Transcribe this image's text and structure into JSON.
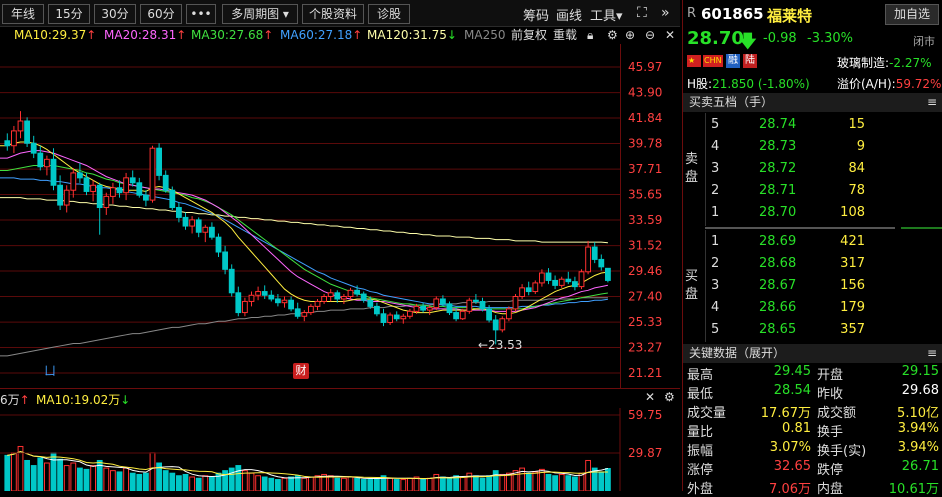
{
  "toolbar": {
    "periods": [
      "年线",
      "15分",
      "30分",
      "60分",
      "•••"
    ],
    "multi_period": "多周期图",
    "stock_info": "个股资料",
    "diagnose": "诊股",
    "chips": "筹码",
    "draw": "画线",
    "tools": "工具",
    "expand_icon": "expand-icon",
    "more_icon": "double-chevron-right-icon"
  },
  "ma_bar": {
    "ma10": "MA10:29.37",
    "ma20": "MA20:28.31",
    "ma30": "MA30:27.68",
    "ma60": "MA60:27.18",
    "ma120": "MA120:31.75",
    "ma250": "MA250",
    "adjust": "前复权",
    "overlay": "重载",
    "colors": {
      "ma10": "#ffee40",
      "ma20": "#ff66ff",
      "ma30": "#40e040",
      "ma60": "#40a0ff",
      "ma120": "#ffffaa",
      "ma250": "#888888"
    }
  },
  "price_axis": [
    "45.97",
    "43.90",
    "41.84",
    "39.78",
    "37.71",
    "35.65",
    "33.59",
    "31.52",
    "29.46",
    "27.40",
    "25.33",
    "23.27",
    "21.21"
  ],
  "low_marker": "←23.53",
  "caitu_badge": "财",
  "volume_bar": {
    "vol_partial": "6万",
    "ma10": "MA10:19.02万"
  },
  "volume_axis": [
    "59.75",
    "29.87"
  ],
  "quote": {
    "r": "R",
    "code": "601865",
    "name": "福莱特",
    "add_watch": "加自选",
    "price": "28.70",
    "change": "-0.98",
    "change_pct": "-3.30%",
    "status": "闭市",
    "tag_chn": "CHN",
    "tag_rong": "融",
    "tag_lu": "陆",
    "sector_label": "玻璃制造",
    "sector_change": "-2.27%",
    "h_label": "H股:",
    "h_price": "21.850",
    "h_change": "(-1.80%)",
    "premium_label": "溢价(A/H):",
    "premium_value": "59.72%"
  },
  "order_book": {
    "title": "买卖五档（手）",
    "sell_label": "卖盘",
    "buy_label": "买盘",
    "sells": [
      {
        "level": "5",
        "price": "28.74",
        "volume": "15"
      },
      {
        "level": "4",
        "price": "28.73",
        "volume": "9"
      },
      {
        "level": "3",
        "price": "28.72",
        "volume": "84"
      },
      {
        "level": "2",
        "price": "28.71",
        "volume": "78"
      },
      {
        "level": "1",
        "price": "28.70",
        "volume": "108"
      }
    ],
    "buys": [
      {
        "level": "1",
        "price": "28.69",
        "volume": "421"
      },
      {
        "level": "2",
        "price": "28.68",
        "volume": "317"
      },
      {
        "level": "3",
        "price": "28.67",
        "volume": "156"
      },
      {
        "level": "4",
        "price": "28.66",
        "volume": "179"
      },
      {
        "level": "5",
        "price": "28.65",
        "volume": "357"
      }
    ]
  },
  "key_data": {
    "title": "关键数据（展开）",
    "rows": [
      {
        "l1": "最高",
        "v1": "29.45",
        "l2": "开盘",
        "v2": "29.15"
      },
      {
        "l1": "最低",
        "v1": "28.54",
        "l2": "昨收",
        "v2": "29.68"
      },
      {
        "l1": "成交量",
        "v1": "17.67万",
        "l2": "成交额",
        "v2": "5.10亿"
      },
      {
        "l1": "量比",
        "v1": "0.81",
        "l2": "换手",
        "v2": "3.94%"
      },
      {
        "l1": "振幅",
        "v1": "3.07%",
        "l2": "换手(实)",
        "v2": "3.94%"
      },
      {
        "l1": "涨停",
        "v1": "32.65",
        "l2": "跌停",
        "v2": "26.71"
      },
      {
        "l1": "外盘",
        "v1": "7.06万",
        "l2": "内盘",
        "v2": "10.61万"
      }
    ]
  },
  "chart_data": {
    "type": "candlestick",
    "ylim": [
      21.21,
      45.97
    ],
    "candles": [
      [
        40.0,
        40.6,
        39.2,
        39.6
      ],
      [
        39.6,
        41.2,
        39.0,
        40.8
      ],
      [
        40.8,
        42.4,
        40.2,
        41.6
      ],
      [
        41.6,
        41.9,
        39.5,
        39.8
      ],
      [
        39.8,
        40.4,
        38.6,
        39.0
      ],
      [
        39.0,
        39.6,
        37.6,
        37.9
      ],
      [
        37.9,
        38.8,
        37.2,
        38.5
      ],
      [
        38.5,
        39.4,
        36.0,
        36.4
      ],
      [
        36.4,
        37.2,
        34.4,
        34.8
      ],
      [
        34.8,
        36.4,
        34.2,
        36.0
      ],
      [
        36.0,
        37.8,
        35.4,
        37.4
      ],
      [
        37.4,
        38.2,
        36.6,
        37.0
      ],
      [
        37.0,
        37.4,
        35.6,
        35.9
      ],
      [
        35.9,
        36.8,
        35.1,
        36.4
      ],
      [
        36.4,
        36.6,
        32.4,
        34.6
      ],
      [
        34.6,
        35.8,
        34.0,
        35.5
      ],
      [
        35.5,
        36.6,
        34.9,
        36.2
      ],
      [
        36.2,
        36.8,
        35.4,
        35.8
      ],
      [
        35.8,
        37.4,
        35.2,
        37.0
      ],
      [
        37.0,
        37.6,
        36.3,
        36.6
      ],
      [
        36.6,
        37.0,
        35.4,
        35.6
      ],
      [
        35.6,
        36.0,
        34.7,
        35.2
      ],
      [
        35.2,
        39.6,
        35.0,
        39.4
      ],
      [
        39.4,
        39.8,
        36.8,
        37.2
      ],
      [
        37.2,
        37.6,
        35.8,
        36.0
      ],
      [
        36.0,
        36.3,
        34.4,
        34.6
      ],
      [
        34.6,
        35.0,
        33.4,
        33.8
      ],
      [
        33.8,
        34.2,
        32.8,
        33.1
      ],
      [
        33.1,
        33.9,
        32.5,
        33.6
      ],
      [
        33.6,
        33.8,
        32.2,
        32.6
      ],
      [
        32.6,
        33.2,
        31.8,
        33.0
      ],
      [
        33.0,
        33.4,
        32.0,
        32.2
      ],
      [
        32.2,
        32.5,
        30.6,
        31.0
      ],
      [
        31.0,
        31.5,
        29.2,
        29.6
      ],
      [
        29.6,
        30.0,
        27.4,
        27.7
      ],
      [
        27.7,
        28.2,
        25.8,
        26.1
      ],
      [
        26.1,
        27.3,
        25.8,
        27.0
      ],
      [
        27.0,
        27.8,
        26.6,
        27.5
      ],
      [
        27.5,
        28.2,
        27.1,
        27.8
      ],
      [
        27.8,
        28.3,
        27.2,
        27.5
      ],
      [
        27.5,
        27.9,
        27.0,
        27.2
      ],
      [
        27.2,
        27.6,
        26.6,
        26.9
      ],
      [
        26.9,
        27.4,
        26.5,
        27.1
      ],
      [
        27.1,
        27.4,
        26.2,
        26.4
      ],
      [
        26.4,
        26.9,
        25.6,
        25.8
      ],
      [
        25.8,
        26.3,
        25.4,
        26.1
      ],
      [
        26.1,
        26.8,
        25.9,
        26.6
      ],
      [
        26.6,
        27.2,
        26.3,
        27.0
      ],
      [
        27.0,
        27.6,
        26.8,
        27.4
      ],
      [
        27.4,
        28.0,
        27.0,
        27.7
      ],
      [
        27.7,
        27.9,
        26.9,
        27.2
      ],
      [
        27.2,
        27.6,
        26.8,
        27.4
      ],
      [
        27.4,
        28.1,
        27.2,
        27.9
      ],
      [
        27.9,
        28.3,
        27.4,
        27.6
      ],
      [
        27.6,
        27.8,
        26.9,
        27.1
      ],
      [
        27.1,
        27.4,
        26.4,
        26.6
      ],
      [
        26.6,
        26.9,
        25.8,
        26.0
      ],
      [
        26.0,
        26.4,
        25.0,
        25.3
      ],
      [
        25.3,
        26.1,
        25.1,
        25.9
      ],
      [
        25.9,
        26.2,
        25.4,
        25.6
      ],
      [
        25.6,
        26.0,
        25.2,
        25.8
      ],
      [
        25.8,
        26.4,
        25.6,
        26.2
      ],
      [
        26.2,
        26.8,
        26.0,
        26.6
      ],
      [
        26.6,
        26.9,
        26.1,
        26.3
      ],
      [
        26.3,
        26.7,
        25.9,
        26.5
      ],
      [
        26.5,
        27.4,
        26.3,
        27.2
      ],
      [
        27.2,
        27.5,
        26.6,
        26.8
      ],
      [
        26.8,
        27.0,
        25.9,
        26.1
      ],
      [
        26.1,
        26.5,
        25.4,
        25.6
      ],
      [
        25.6,
        26.4,
        25.5,
        26.2
      ],
      [
        26.2,
        27.3,
        26.0,
        27.1
      ],
      [
        27.1,
        27.6,
        26.8,
        27.0
      ],
      [
        27.0,
        27.3,
        26.2,
        26.4
      ],
      [
        26.4,
        26.7,
        25.3,
        25.5
      ],
      [
        25.5,
        25.9,
        23.53,
        24.7
      ],
      [
        24.7,
        25.8,
        24.5,
        25.6
      ],
      [
        25.6,
        26.6,
        25.4,
        26.4
      ],
      [
        26.4,
        27.6,
        26.2,
        27.4
      ],
      [
        27.4,
        28.4,
        27.2,
        28.1
      ],
      [
        28.1,
        28.6,
        27.5,
        27.8
      ],
      [
        27.8,
        28.7,
        27.6,
        28.5
      ],
      [
        28.5,
        29.6,
        28.2,
        29.3
      ],
      [
        29.3,
        29.7,
        28.4,
        28.7
      ],
      [
        28.7,
        29.1,
        28.0,
        28.3
      ],
      [
        28.3,
        29.0,
        28.1,
        28.8
      ],
      [
        28.8,
        29.4,
        28.4,
        28.6
      ],
      [
        28.6,
        29.0,
        27.9,
        28.2
      ],
      [
        28.2,
        29.6,
        28.0,
        29.4
      ],
      [
        29.4,
        31.9,
        29.2,
        31.4
      ],
      [
        31.4,
        31.8,
        30.1,
        30.4
      ],
      [
        30.4,
        30.8,
        29.5,
        29.8
      ],
      [
        29.68,
        29.45,
        28.54,
        28.7
      ]
    ],
    "ma10": [
      39.6,
      39.8,
      39.9,
      39.9,
      39.8,
      39.6,
      39.3,
      38.9,
      38.5,
      38.1,
      37.7,
      37.4,
      37.1,
      36.8,
      36.5,
      36.3,
      36.2,
      36.1,
      36.0,
      36.0,
      36.0,
      35.9,
      36.2,
      36.3,
      36.2,
      36.0,
      35.7,
      35.4,
      35.1,
      34.8,
      34.5,
      34.2,
      33.8,
      33.4,
      32.9,
      32.2,
      31.6,
      31.0,
      30.4,
      29.8,
      29.2,
      28.6,
      28.0,
      27.6,
      27.3,
      27.1,
      27.0,
      27.0,
      27.0,
      27.0,
      27.0,
      27.0,
      27.1,
      27.2,
      27.2,
      27.2,
      27.1,
      26.9,
      26.7,
      26.5,
      26.3,
      26.2,
      26.1,
      26.1,
      26.1,
      26.2,
      26.3,
      26.3,
      26.3,
      26.3,
      26.3,
      26.4,
      26.4,
      26.3,
      26.1,
      26.0,
      26.0,
      26.1,
      26.3,
      26.6,
      26.9,
      27.2,
      27.5,
      27.8,
      28.0,
      28.2,
      28.3,
      28.5,
      28.8,
      29.1,
      29.3,
      29.37
    ],
    "ma20": [
      38.6,
      38.8,
      39.0,
      39.1,
      39.2,
      39.2,
      39.1,
      39.0,
      38.8,
      38.6,
      38.4,
      38.2,
      38.0,
      37.7,
      37.4,
      37.1,
      36.9,
      36.7,
      36.5,
      36.4,
      36.3,
      36.2,
      36.1,
      36.1,
      36.0,
      35.9,
      35.8,
      35.7,
      35.6,
      35.4,
      35.2,
      34.9,
      34.6,
      34.2,
      33.8,
      33.4,
      32.9,
      32.4,
      31.9,
      31.4,
      30.9,
      30.4,
      29.9,
      29.4,
      29.0,
      28.7,
      28.4,
      28.1,
      27.8,
      27.6,
      27.4,
      27.3,
      27.2,
      27.1,
      27.1,
      27.0,
      27.0,
      27.0,
      26.9,
      26.8,
      26.7,
      26.6,
      26.5,
      26.5,
      26.4,
      26.4,
      26.4,
      26.4,
      26.4,
      26.3,
      26.3,
      26.3,
      26.3,
      26.3,
      26.2,
      26.2,
      26.2,
      26.2,
      26.3,
      26.4,
      26.5,
      26.7,
      26.9,
      27.1,
      27.3,
      27.4,
      27.6,
      27.8,
      27.9,
      28.1,
      28.2,
      28.31
    ],
    "ma30": [
      37.6,
      37.7,
      37.8,
      37.9,
      38.0,
      38.0,
      38.0,
      38.0,
      37.9,
      37.8,
      37.7,
      37.6,
      37.4,
      37.3,
      37.1,
      36.9,
      36.8,
      36.6,
      36.5,
      36.4,
      36.3,
      36.2,
      36.1,
      36.0,
      35.9,
      35.8,
      35.7,
      35.6,
      35.4,
      35.3,
      35.1,
      34.9,
      34.6,
      34.3,
      34.0,
      33.6,
      33.2,
      32.8,
      32.4,
      32.0,
      31.6,
      31.2,
      30.8,
      30.4,
      30.0,
      29.6,
      29.3,
      29.0,
      28.7,
      28.4,
      28.2,
      28.0,
      27.8,
      27.6,
      27.5,
      27.3,
      27.2,
      27.1,
      27.0,
      26.9,
      26.8,
      26.8,
      26.7,
      26.7,
      26.6,
      26.6,
      26.6,
      26.5,
      26.5,
      26.5,
      26.5,
      26.4,
      26.4,
      26.4,
      26.4,
      26.4,
      26.4,
      26.4,
      26.4,
      26.5,
      26.6,
      26.7,
      26.8,
      26.9,
      27.0,
      27.1,
      27.2,
      27.3,
      27.4,
      27.5,
      27.6,
      27.68
    ],
    "ma60": [
      37.0,
      37.0,
      36.9,
      36.9,
      36.9,
      36.8,
      36.8,
      36.7,
      36.7,
      36.6,
      36.5,
      36.5,
      36.4,
      36.3,
      36.2,
      36.2,
      36.1,
      36.0,
      35.9,
      35.8,
      35.7,
      35.6,
      35.5,
      35.4,
      35.3,
      35.2,
      35.0,
      34.9,
      34.7,
      34.5,
      34.3,
      34.1,
      33.9,
      33.6,
      33.3,
      33.0,
      32.7,
      32.4,
      32.1,
      31.8,
      31.5,
      31.2,
      30.9,
      30.6,
      30.3,
      30.0,
      29.7,
      29.4,
      29.2,
      28.9,
      28.7,
      28.5,
      28.3,
      28.1,
      28.0,
      27.8,
      27.7,
      27.5,
      27.4,
      27.3,
      27.2,
      27.1,
      27.0,
      26.9,
      26.8,
      26.8,
      26.7,
      26.7,
      26.6,
      26.6,
      26.6,
      26.6,
      26.5,
      26.5,
      26.5,
      26.5,
      26.5,
      26.5,
      26.6,
      26.6,
      26.6,
      26.7,
      26.7,
      26.8,
      26.8,
      26.9,
      26.9,
      27.0,
      27.0,
      27.1,
      27.1,
      27.18
    ],
    "ma120": [
      35.4,
      35.4,
      35.4,
      35.3,
      35.3,
      35.3,
      35.2,
      35.2,
      35.2,
      35.1,
      35.1,
      35.0,
      35.0,
      34.9,
      34.9,
      34.8,
      34.8,
      34.7,
      34.7,
      34.6,
      34.6,
      34.5,
      34.5,
      34.4,
      34.4,
      34.3,
      34.3,
      34.2,
      34.2,
      34.1,
      34.1,
      34.0,
      34.0,
      33.9,
      33.9,
      33.8,
      33.8,
      33.7,
      33.7,
      33.6,
      33.6,
      33.5,
      33.5,
      33.4,
      33.4,
      33.3,
      33.3,
      33.2,
      33.2,
      33.1,
      33.1,
      33.0,
      33.0,
      32.9,
      32.9,
      32.8,
      32.8,
      32.7,
      32.7,
      32.6,
      32.6,
      32.5,
      32.5,
      32.4,
      32.4,
      32.3,
      32.3,
      32.3,
      32.2,
      32.2,
      32.2,
      32.1,
      32.1,
      32.1,
      32.0,
      32.0,
      32.0,
      31.9,
      31.9,
      31.9,
      31.9,
      31.8,
      31.8,
      31.8,
      31.8,
      31.8,
      31.8,
      31.8,
      31.8,
      31.8,
      31.8,
      31.75
    ],
    "ma250": [
      22.6,
      22.7,
      22.8,
      22.9,
      23.0,
      23.1,
      23.2,
      23.3,
      23.4,
      23.5,
      23.6,
      23.6,
      23.7,
      23.8,
      23.9,
      24.0,
      24.1,
      24.2,
      24.3,
      24.4,
      24.4,
      24.5,
      24.6,
      24.7,
      24.8,
      24.9,
      24.9,
      25.0,
      25.1,
      25.2,
      25.2,
      25.3,
      25.4,
      25.4,
      25.5,
      25.6,
      25.6,
      25.7,
      25.7,
      25.8,
      25.8,
      25.9,
      25.9,
      26.0,
      26.0,
      26.1,
      26.1,
      26.2,
      26.2,
      26.3,
      26.3,
      26.3,
      26.4,
      26.4,
      26.4,
      26.5,
      26.5,
      26.5,
      26.6,
      26.6,
      26.6,
      26.7,
      26.7,
      26.7,
      26.7,
      26.8,
      26.8,
      26.8,
      26.8,
      26.9,
      26.9,
      26.9,
      26.9,
      27.0,
      27.0,
      27.0,
      27.0,
      27.1,
      27.1,
      27.1,
      27.1,
      27.1,
      27.2,
      27.2,
      27.2,
      27.2,
      27.2,
      27.3,
      27.3,
      27.3,
      27.3,
      27.3
    ],
    "volumes": [
      28,
      30,
      35,
      24,
      20,
      26,
      22,
      30,
      25,
      20,
      22,
      18,
      17,
      20,
      24,
      18,
      16,
      15,
      18,
      14,
      13,
      14,
      30,
      22,
      16,
      14,
      12,
      13,
      11,
      10,
      12,
      11,
      14,
      16,
      18,
      20,
      16,
      14,
      12,
      11,
      10,
      9,
      10,
      11,
      12,
      10,
      11,
      12,
      13,
      12,
      10,
      10,
      11,
      10,
      9,
      9,
      10,
      12,
      10,
      9,
      9,
      10,
      11,
      9,
      10,
      13,
      11,
      10,
      12,
      11,
      14,
      12,
      10,
      12,
      16,
      13,
      14,
      16,
      18,
      14,
      15,
      17,
      13,
      12,
      13,
      12,
      11,
      14,
      24,
      18,
      15,
      17.67
    ],
    "vol_ylim": [
      0,
      59.75
    ]
  }
}
